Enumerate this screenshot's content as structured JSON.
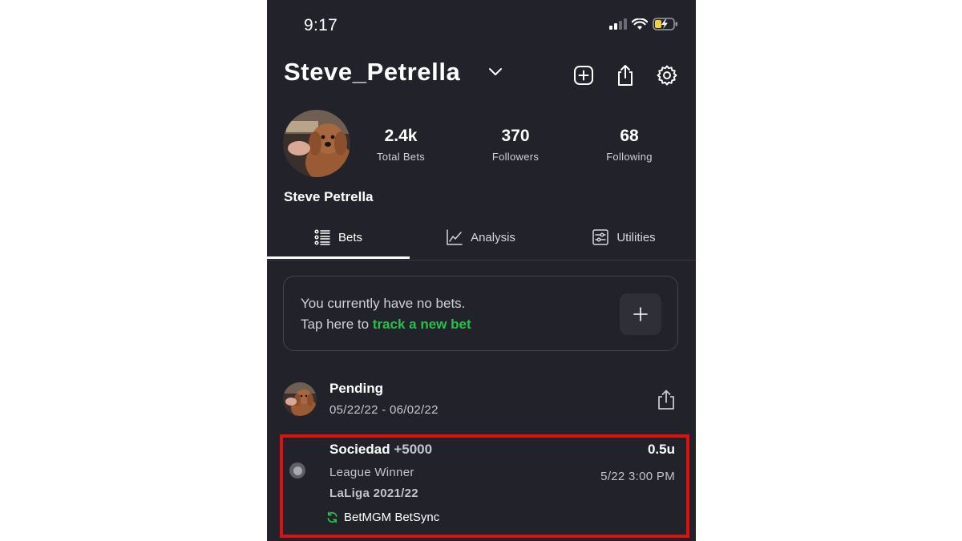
{
  "status_bar": {
    "time": "9:17"
  },
  "header": {
    "username": "Steve_Petrella"
  },
  "profile": {
    "full_name": "Steve Petrella",
    "stats": [
      {
        "value": "2.4k",
        "label": "Total Bets"
      },
      {
        "value": "370",
        "label": "Followers"
      },
      {
        "value": "68",
        "label": "Following"
      }
    ]
  },
  "tabs": [
    {
      "label": "Bets",
      "icon": "list-icon",
      "active": true
    },
    {
      "label": "Analysis",
      "icon": "line-chart-icon",
      "active": false
    },
    {
      "label": "Utilities",
      "icon": "sliders-icon",
      "active": false
    }
  ],
  "no_bets": {
    "line1": "You currently have no bets.",
    "line2_prefix": "Tap here to ",
    "line2_link": "track a new bet"
  },
  "pending": {
    "title": "Pending",
    "dates": "05/22/22 - 06/02/22"
  },
  "bet": {
    "team": "Sociedad",
    "odds": "+5000",
    "market": "League Winner",
    "league": "LaLiga 2021/22",
    "sync": "BetMGM BetSync",
    "units": "0.5u",
    "time": "5/22 3:00 PM"
  },
  "colors": {
    "background": "#22232a",
    "link_green": "#27c04a",
    "highlight_red": "#e20f0f"
  }
}
